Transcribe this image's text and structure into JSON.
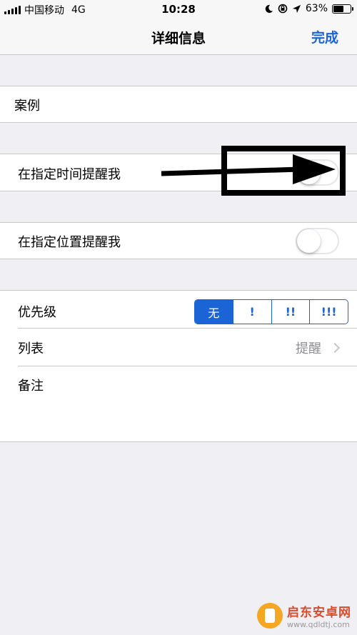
{
  "status": {
    "carrier": "中国移动",
    "network": "4G",
    "time": "10:28",
    "battery": "63%",
    "battery_level": 0.63
  },
  "nav": {
    "title": "详细信息",
    "done": "完成"
  },
  "title_field": {
    "value": "案例"
  },
  "remind_time": {
    "label": "在指定时间提醒我",
    "on": false
  },
  "remind_location": {
    "label": "在指定位置提醒我",
    "on": false
  },
  "priority": {
    "label": "优先级",
    "options": [
      "无",
      "!",
      "!!",
      "!!!"
    ],
    "selected": "无"
  },
  "list": {
    "label": "列表",
    "value": "提醒"
  },
  "notes": {
    "label": "备注"
  },
  "watermark": {
    "title": "启东安卓网",
    "url": "www.qdldtj.com"
  }
}
